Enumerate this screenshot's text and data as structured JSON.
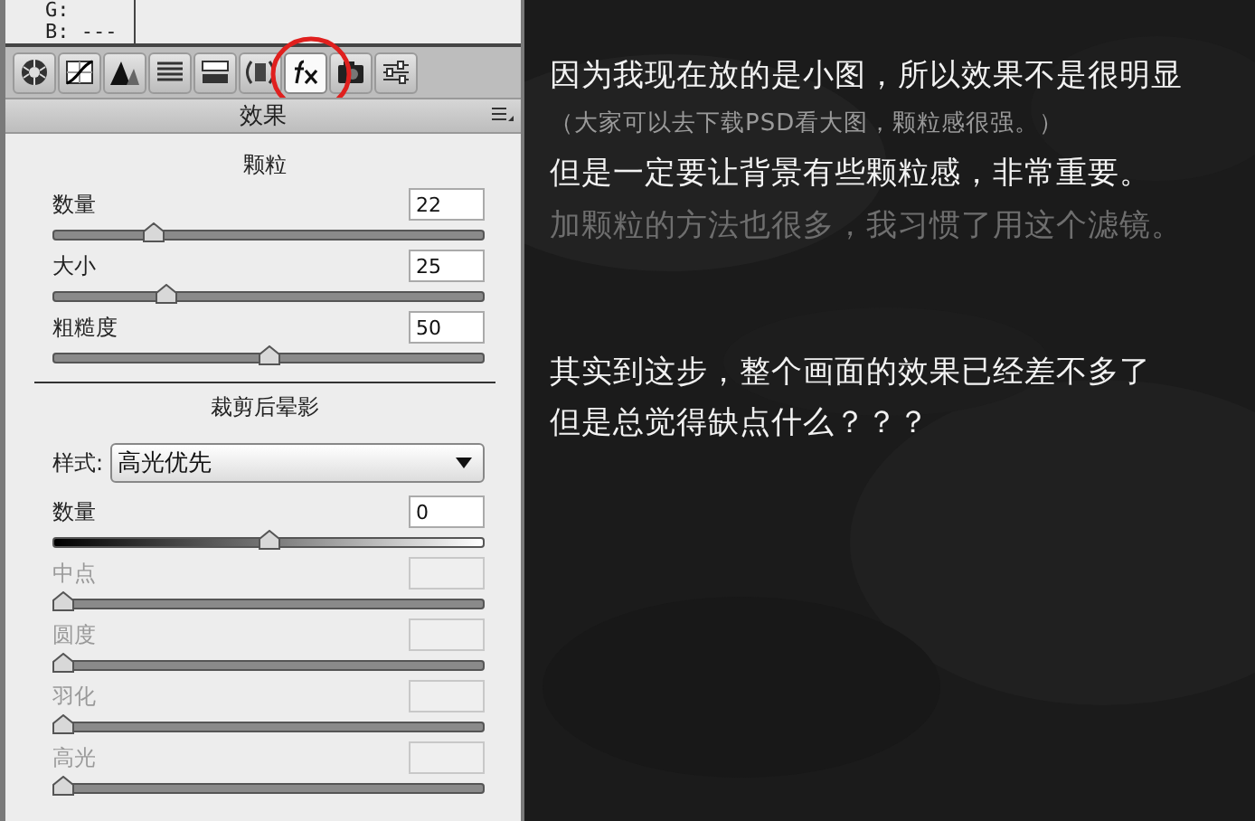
{
  "readout": [
    "G:",
    "B: ---"
  ],
  "toolbar": {
    "tabs": [
      {
        "kind": "aperture",
        "selected": false
      },
      {
        "kind": "curve",
        "selected": false
      },
      {
        "kind": "detail",
        "selected": false
      },
      {
        "kind": "hsl",
        "selected": false
      },
      {
        "kind": "split",
        "selected": false
      },
      {
        "kind": "lens",
        "selected": false
      },
      {
        "kind": "fx",
        "selected": true
      },
      {
        "kind": "camera",
        "selected": false
      },
      {
        "kind": "presets",
        "selected": false
      }
    ]
  },
  "panel": {
    "title": "效果",
    "grain": {
      "title": "颗粒",
      "sliders": [
        {
          "label": "数量",
          "value": "22",
          "level": 0.22,
          "kind": "plain",
          "disabled": false
        },
        {
          "label": "大小",
          "value": "25",
          "level": 0.25,
          "kind": "plain",
          "disabled": false
        },
        {
          "label": "粗糙度",
          "value": "50",
          "level": 0.5,
          "kind": "plain",
          "disabled": false
        }
      ]
    },
    "vignette": {
      "title": "裁剪后晕影",
      "style": {
        "label": "样式:",
        "value": "高光优先"
      },
      "sliders": [
        {
          "label": "数量",
          "value": "0",
          "level": 0.5,
          "kind": "gradient",
          "disabled": false
        },
        {
          "label": "中点",
          "level": 0,
          "kind": "plain",
          "disabled": true
        },
        {
          "label": "圆度",
          "level": 0,
          "kind": "plain",
          "disabled": true
        },
        {
          "label": "羽化",
          "level": 0,
          "kind": "plain",
          "disabled": true
        },
        {
          "label": "高光",
          "level": 0,
          "kind": "plain",
          "disabled": true
        }
      ]
    }
  },
  "note_groups": [
    {
      "lines": [
        {
          "text": "因为我现在放的是小图，所以效果不是很明显",
          "kind": "primary"
        },
        {
          "text": "（大家可以去下载PSD看大图，颗粒感很强。）",
          "kind": "small"
        },
        {
          "text": "但是一定要让背景有些颗粒感，非常重要。",
          "kind": "primary"
        },
        {
          "text": "加颗粒的方法也很多，我习惯了用这个滤镜。",
          "kind": "dim"
        }
      ]
    },
    {
      "lines": [
        {
          "text": "其实到这步，整个画面的效果已经差不多了",
          "kind": "primary"
        },
        {
          "text": "但是总觉得缺点什么？？？",
          "kind": "primary"
        }
      ]
    }
  ]
}
